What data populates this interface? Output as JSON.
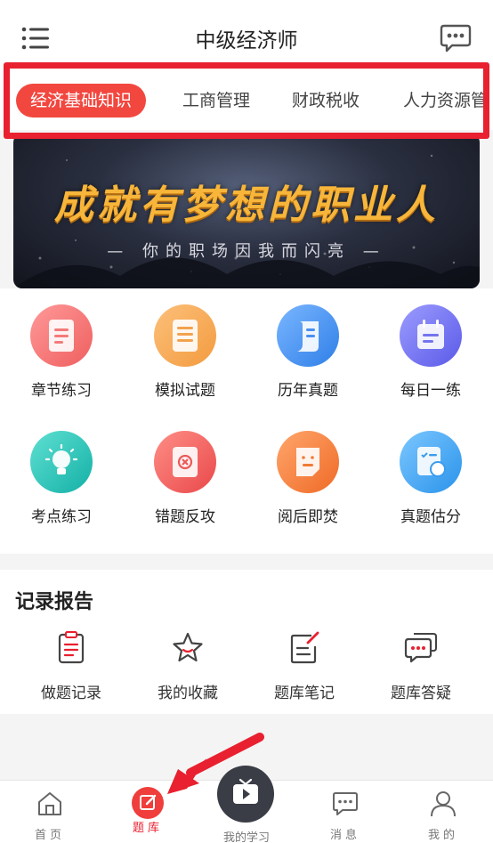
{
  "header": {
    "title": "中级经济师"
  },
  "tabs": [
    {
      "label": "经济基础知识"
    },
    {
      "label": "工商管理"
    },
    {
      "label": "财政税收"
    },
    {
      "label": "人力资源管"
    }
  ],
  "banner": {
    "title": "成就有梦想的职业人",
    "subtitle": "— 你的职场因我而闪亮 —"
  },
  "grid": [
    {
      "label": "章节练习",
      "icon": "document-icon",
      "color": "#f26b6b"
    },
    {
      "label": "模拟试题",
      "icon": "list-doc-icon",
      "color": "#f5a04a"
    },
    {
      "label": "历年真题",
      "icon": "scroll-icon",
      "color": "#3e8ef0"
    },
    {
      "label": "每日一练",
      "icon": "calendar-icon",
      "color": "#6c6cf0"
    },
    {
      "label": "考点练习",
      "icon": "lightbulb-icon",
      "color": "#23c2b8"
    },
    {
      "label": "错题反攻",
      "icon": "error-book-icon",
      "color": "#ee5d58"
    },
    {
      "label": "阅后即焚",
      "icon": "sticky-note-icon",
      "color": "#f4782f"
    },
    {
      "label": "真题估分",
      "icon": "checklist-icon",
      "color": "#3aa5f2"
    }
  ],
  "record": {
    "title": "记录报告",
    "items": [
      {
        "label": "做题记录",
        "icon": "clipboard-icon"
      },
      {
        "label": "我的收藏",
        "icon": "star-icon"
      },
      {
        "label": "题库笔记",
        "icon": "note-edit-icon"
      },
      {
        "label": "题库答疑",
        "icon": "qa-chat-icon"
      }
    ]
  },
  "nav": {
    "home": "首页",
    "bank": "题库",
    "study": "我的学习",
    "messages": "消息",
    "me": "我的"
  },
  "colors": {
    "accent": "#e8202f",
    "tab_active": "#f2473f"
  }
}
